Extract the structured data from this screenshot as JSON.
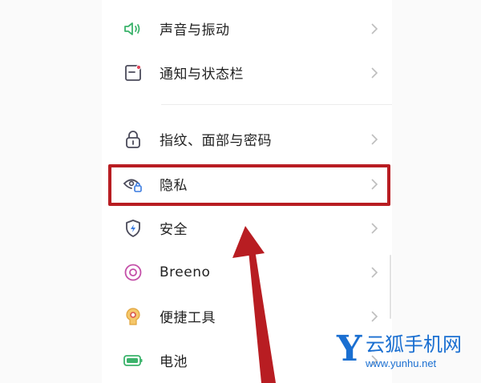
{
  "settings": {
    "items": [
      {
        "label": "声音与振动",
        "icon": "speaker-icon"
      },
      {
        "label": "通知与状态栏",
        "icon": "notification-icon"
      },
      {
        "label": "指纹、面部与密码",
        "icon": "lock-icon"
      },
      {
        "label": "隐私",
        "icon": "privacy-eye-icon"
      },
      {
        "label": "安全",
        "icon": "shield-icon"
      },
      {
        "label": "Breeno",
        "icon": "breeno-icon"
      },
      {
        "label": "便捷工具",
        "icon": "tools-icon"
      },
      {
        "label": "电池",
        "icon": "battery-icon"
      }
    ]
  },
  "watermark": {
    "letter": "Y",
    "title": "云狐手机网",
    "url": "www.yunhu.net"
  },
  "colors": {
    "highlight": "#b81d22",
    "accent": "#1a6fd1"
  }
}
